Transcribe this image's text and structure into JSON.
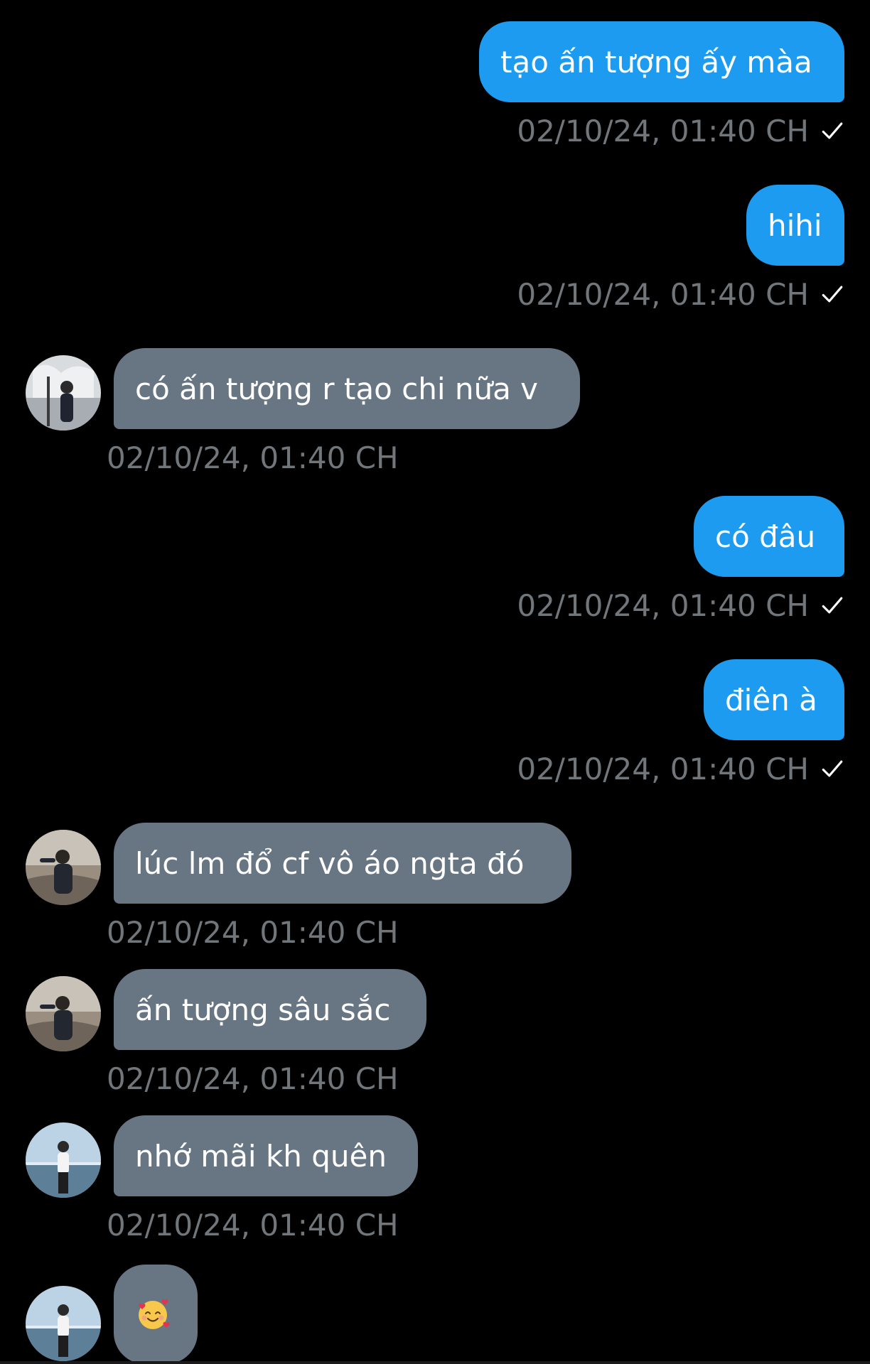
{
  "messages": [
    {
      "text": "tạo ấn tượng ấy màa",
      "time": "02/10/24, 01:40 CH"
    },
    {
      "text": "hihi",
      "time": "02/10/24, 01:40 CH"
    },
    {
      "text": "có ấn tượng r tạo chi nữa v",
      "time": "02/10/24, 01:40 CH"
    },
    {
      "text": "có đâu",
      "time": "02/10/24, 01:40 CH"
    },
    {
      "text": "điên à",
      "time": "02/10/24, 01:40 CH"
    },
    {
      "text": "lúc lm đổ cf vô áo ngta đó",
      "time": "02/10/24, 01:40 CH"
    },
    {
      "text": "ấn tượng sâu sắc",
      "time": "02/10/24, 01:40 CH"
    },
    {
      "text": "nhớ mãi kh quên",
      "time": "02/10/24, 01:40 CH"
    },
    {
      "text": "🥰",
      "emoji": "smiling-face-with-hearts"
    }
  ],
  "colors": {
    "outgoing_bubble": "#1d9bf0",
    "incoming_bubble": "#687684",
    "timestamp": "#71767b",
    "background": "#000000"
  },
  "icons": {
    "sent": "check-icon",
    "avatar": "contact-avatar"
  }
}
